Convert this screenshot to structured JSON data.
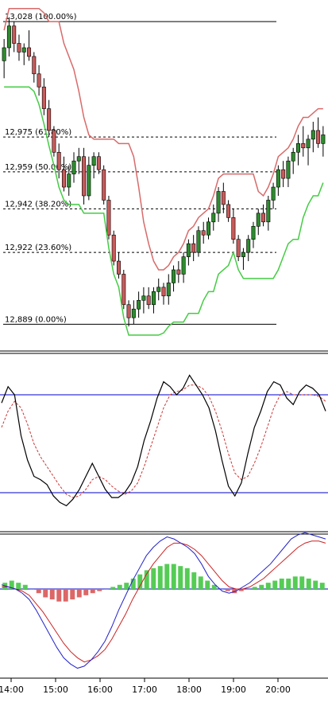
{
  "chart_data": [
    {
      "type": "candlestick",
      "panel": "price",
      "fib_levels": [
        {
          "label": "13,028 (100.00%)",
          "value": 13028,
          "style": "solid"
        },
        {
          "label": "12,975 (61.80%)",
          "value": 12975,
          "style": "dashed"
        },
        {
          "label": "12,959 (50.00%)",
          "value": 12959,
          "style": "dashed"
        },
        {
          "label": "12,942 (38.20%)",
          "value": 12942,
          "style": "dashed"
        },
        {
          "label": "12,922 (23.60%)",
          "value": 12922,
          "style": "dashed"
        },
        {
          "label": "12,889 (0.00%)",
          "value": 12889,
          "style": "solid"
        }
      ],
      "ylim": [
        12880,
        13035
      ],
      "bar_count": 100,
      "candles": [
        [
          13010,
          13020,
          13002,
          13016
        ],
        [
          13016,
          13030,
          13012,
          13026
        ],
        [
          13026,
          13028,
          13014,
          13018
        ],
        [
          13018,
          13022,
          13010,
          13014
        ],
        [
          13014,
          13018,
          13008,
          13016
        ],
        [
          13016,
          13024,
          13010,
          13012
        ],
        [
          13012,
          13014,
          13000,
          13004
        ],
        [
          13004,
          13008,
          12994,
          12998
        ],
        [
          12998,
          13002,
          12985,
          12988
        ],
        [
          12988,
          12992,
          12975,
          12978
        ],
        [
          12978,
          12980,
          12966,
          12968
        ],
        [
          12968,
          12972,
          12956,
          12960
        ],
        [
          12960,
          12966,
          12950,
          12952
        ],
        [
          12952,
          12962,
          12948,
          12958
        ],
        [
          12958,
          12968,
          12954,
          12964
        ],
        [
          12964,
          12970,
          12958,
          12966
        ],
        [
          12966,
          12970,
          12944,
          12948
        ],
        [
          12948,
          12966,
          12946,
          12962
        ],
        [
          12962,
          12968,
          12956,
          12966
        ],
        [
          12966,
          12968,
          12958,
          12960
        ],
        [
          12960,
          12962,
          12944,
          12946
        ],
        [
          12946,
          12948,
          12928,
          12930
        ],
        [
          12930,
          12932,
          12916,
          12918
        ],
        [
          12918,
          12922,
          12910,
          12912
        ],
        [
          12912,
          12914,
          12896,
          12898
        ],
        [
          12898,
          12900,
          12888,
          12892
        ],
        [
          12892,
          12900,
          12889,
          12896
        ],
        [
          12896,
          12904,
          12892,
          12900
        ],
        [
          12900,
          12906,
          12894,
          12902
        ],
        [
          12902,
          12906,
          12896,
          12898
        ],
        [
          12898,
          12906,
          12894,
          12904
        ],
        [
          12904,
          12910,
          12900,
          12906
        ],
        [
          12906,
          12908,
          12898,
          12902
        ],
        [
          12902,
          12912,
          12898,
          12908
        ],
        [
          12908,
          12916,
          12904,
          12914
        ],
        [
          12914,
          12918,
          12908,
          12912
        ],
        [
          12912,
          12922,
          12908,
          12920
        ],
        [
          12920,
          12928,
          12916,
          12926
        ],
        [
          12926,
          12930,
          12918,
          12922
        ],
        [
          12922,
          12934,
          12920,
          12932
        ],
        [
          12932,
          12936,
          12926,
          12930
        ],
        [
          12930,
          12938,
          12928,
          12936
        ],
        [
          12936,
          12944,
          12932,
          12940
        ],
        [
          12940,
          12952,
          12936,
          12950
        ],
        [
          12950,
          12954,
          12940,
          12944
        ],
        [
          12944,
          12946,
          12936,
          12938
        ],
        [
          12938,
          12942,
          12926,
          12928
        ],
        [
          12928,
          12930,
          12918,
          12920
        ],
        [
          12920,
          12924,
          12914,
          12922
        ],
        [
          12922,
          12930,
          12918,
          12928
        ],
        [
          12928,
          12936,
          12924,
          12934
        ],
        [
          12934,
          12942,
          12930,
          12940
        ],
        [
          12940,
          12944,
          12934,
          12936
        ],
        [
          12936,
          12948,
          12932,
          12946
        ],
        [
          12946,
          12954,
          12942,
          12952
        ],
        [
          12952,
          12962,
          12948,
          12960
        ],
        [
          12960,
          12964,
          12952,
          12956
        ],
        [
          12956,
          12966,
          12952,
          12964
        ],
        [
          12964,
          12970,
          12958,
          12968
        ],
        [
          12968,
          12976,
          12962,
          12972
        ],
        [
          12972,
          12980,
          12966,
          12970
        ],
        [
          12970,
          12976,
          12962,
          12974
        ],
        [
          12974,
          12982,
          12968,
          12978
        ],
        [
          12978,
          12984,
          12970,
          12972
        ],
        [
          12972,
          12980,
          12966,
          12976
        ]
      ],
      "series": []
    },
    {
      "type": "line",
      "panel": "stochastic",
      "ylim": [
        0,
        100
      ],
      "levels": [
        80,
        20
      ],
      "k": [
        75,
        85,
        80,
        55,
        40,
        30,
        28,
        25,
        18,
        14,
        12,
        16,
        22,
        30,
        38,
        30,
        22,
        17,
        17,
        20,
        26,
        36,
        52,
        64,
        78,
        88,
        85,
        80,
        84,
        92,
        86,
        80,
        72,
        58,
        40,
        24,
        18,
        26,
        44,
        60,
        70,
        82,
        88,
        86,
        78,
        74,
        82,
        86,
        84,
        80,
        70
      ],
      "d": [
        60,
        70,
        76,
        72,
        62,
        50,
        42,
        36,
        30,
        24,
        19,
        17,
        18,
        22,
        28,
        30,
        28,
        24,
        21,
        19,
        21,
        26,
        36,
        48,
        60,
        72,
        80,
        82,
        83,
        86,
        86,
        84,
        79,
        70,
        58,
        44,
        32,
        28,
        30,
        38,
        48,
        60,
        72,
        80,
        82,
        80,
        80,
        80,
        80,
        79,
        76
      ]
    },
    {
      "type": "bar",
      "panel": "macd",
      "histogram": [
        3,
        4,
        3,
        2,
        0,
        -2,
        -4,
        -5,
        -6,
        -6,
        -5,
        -4,
        -3,
        -2,
        -1,
        0,
        1,
        2,
        3,
        5,
        7,
        9,
        10,
        11,
        12,
        12,
        11,
        10,
        8,
        6,
        4,
        2,
        0,
        -1,
        -2,
        -1,
        0,
        1,
        2,
        3,
        4,
        5,
        5,
        6,
        6,
        5,
        4,
        3
      ],
      "macd_line": [
        2,
        1,
        0,
        -2,
        -5,
        -10,
        -16,
        -22,
        -28,
        -33,
        -36,
        -38,
        -37,
        -34,
        -30,
        -25,
        -18,
        -10,
        -3,
        4,
        10,
        16,
        20,
        23,
        25,
        24,
        22,
        20,
        17,
        12,
        6,
        2,
        -1,
        -2,
        -1,
        1,
        3,
        6,
        9,
        12,
        16,
        20,
        24,
        26,
        27,
        26,
        25,
        24
      ],
      "signal_line": [
        1,
        1,
        0,
        -1,
        -3,
        -7,
        -11,
        -16,
        -21,
        -26,
        -30,
        -33,
        -35,
        -34,
        -32,
        -29,
        -24,
        -18,
        -12,
        -5,
        1,
        7,
        12,
        16,
        20,
        22,
        22,
        21,
        19,
        16,
        12,
        8,
        4,
        1,
        0,
        0,
        1,
        3,
        5,
        8,
        11,
        14,
        17,
        20,
        22,
        23,
        23,
        22
      ]
    }
  ],
  "x_axis": {
    "ticks": [
      "14:00",
      "15:00",
      "16:00",
      "17:00",
      "18:00",
      "19:00",
      "20:00"
    ]
  },
  "colors": {
    "bull": "#2e8b2e",
    "bear": "#c85a5a",
    "resist": "#d96a6a",
    "support": "#44cc44",
    "stoch_k": "#000000",
    "stoch_d": "#cc3333",
    "macd": "#2222cc",
    "signal": "#cc2222",
    "hist_up": "#55cc55",
    "hist_down": "#dd6666",
    "level": "#0000cc"
  }
}
